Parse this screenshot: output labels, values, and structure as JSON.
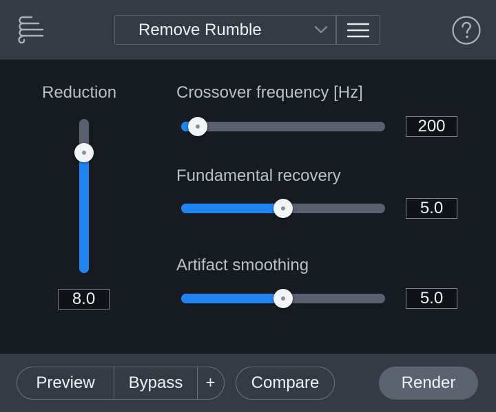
{
  "header": {
    "preset_name": "Remove Rumble",
    "icons": {
      "app": "wind-lines-icon",
      "dropdown": "chevron-down-icon",
      "menu": "hamburger-menu-icon",
      "help": "help-circle-icon"
    }
  },
  "controls": {
    "reduction": {
      "label": "Reduction",
      "value": "8.0",
      "level": 0.78
    },
    "crossover": {
      "label": "Crossover frequency [Hz]",
      "value": "200",
      "level": 0.08
    },
    "fundamental": {
      "label": "Fundamental recovery",
      "value": "5.0",
      "level": 0.5
    },
    "artifact": {
      "label": "Artifact smoothing",
      "value": "5.0",
      "level": 0.5
    }
  },
  "footer": {
    "preview_label": "Preview",
    "bypass_label": "Bypass",
    "plus_label": "+",
    "compare_label": "Compare",
    "render_label": "Render"
  },
  "colors": {
    "accent": "#1f83f0",
    "header_bg": "#353b44",
    "body_bg": "#161b21"
  }
}
